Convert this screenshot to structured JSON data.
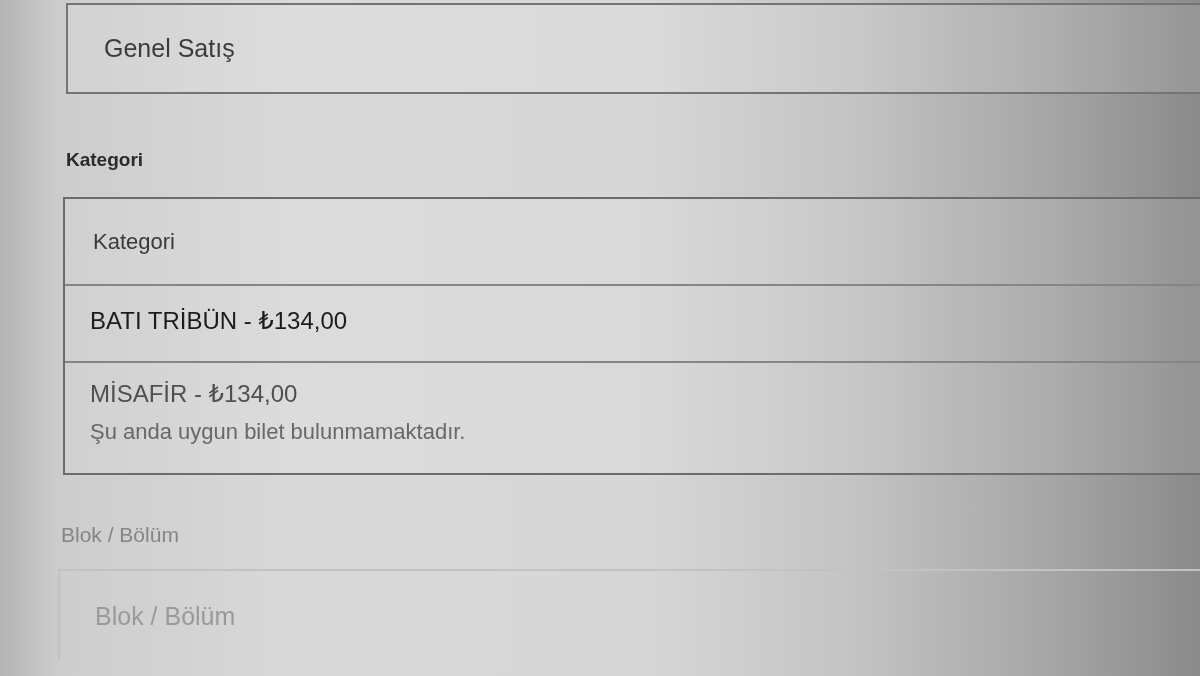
{
  "ticket_type_select": {
    "value": "Genel Satış"
  },
  "category": {
    "label": "Kategori",
    "placeholder": "Kategori",
    "options": [
      {
        "label": "BATI TRİBÜN - ₺134,00",
        "disabled": false
      },
      {
        "label": "MİSAFİR - ₺134,00",
        "disabled": true,
        "note": "Şu anda uygun bilet bulunmamaktadır."
      }
    ]
  },
  "block": {
    "label": "Blok / Bölüm",
    "placeholder": "Blok / Bölüm",
    "disabled": true
  }
}
